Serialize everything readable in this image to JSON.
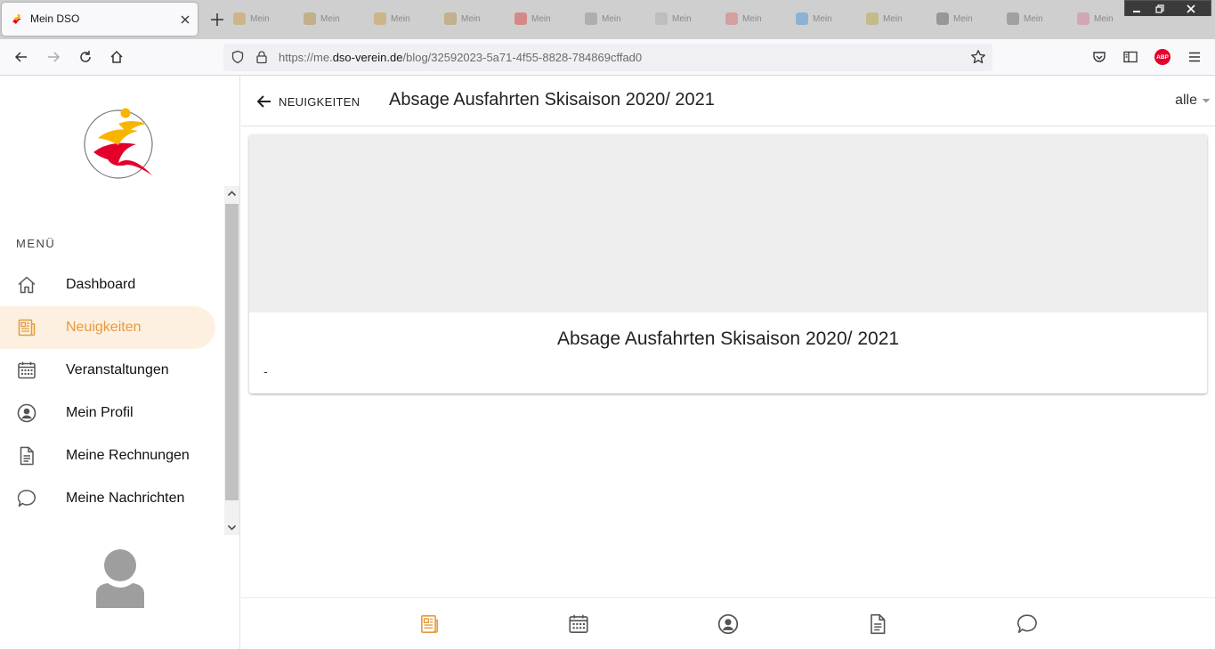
{
  "browser": {
    "tab_title": "Mein DSO",
    "url_prefix": "https://me.",
    "url_domain": "dso-verein.de",
    "url_path": "/blog/32592023-5a71-4f55-8828-784869cffad0",
    "background_tabs": [
      "Mein",
      "Mein",
      "Mein",
      "Mein",
      "Mein",
      "Mein",
      "Mein",
      "Mein",
      "Mein",
      "Mein",
      "Mein",
      "Mein",
      "Mein"
    ],
    "abp_label": "ABP"
  },
  "sidebar": {
    "menu_heading": "MENÜ",
    "items": [
      {
        "label": "Dashboard",
        "icon": "home-icon",
        "active": false
      },
      {
        "label": "Neuigkeiten",
        "icon": "newspaper-icon",
        "active": true
      },
      {
        "label": "Veranstaltungen",
        "icon": "calendar-icon",
        "active": false
      },
      {
        "label": "Mein Profil",
        "icon": "profile-icon",
        "active": false
      },
      {
        "label": "Meine Rechnungen",
        "icon": "invoice-icon",
        "active": false
      },
      {
        "label": "Meine Nachrichten",
        "icon": "chat-icon",
        "active": false
      }
    ]
  },
  "topbar": {
    "back_label": "NEUIGKEITEN",
    "title": "Absage Ausfahrten Skisaison 2020/ 2021",
    "filter_label": "alle"
  },
  "article": {
    "title": "Absage Ausfahrten Skisaison 2020/ 2021",
    "body": "-"
  },
  "colors": {
    "accent": "#e69a3e",
    "active_bg": "#fdf0e0"
  }
}
